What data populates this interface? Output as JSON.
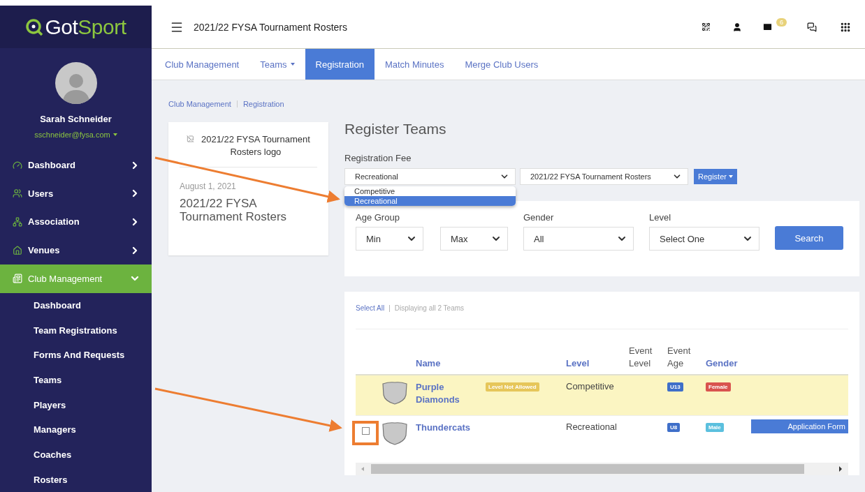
{
  "brand": {
    "first": "Got",
    "second": "Sport"
  },
  "topbar": {
    "title": "2021/22 FYSA Tournament Rosters",
    "mail_badge": "6"
  },
  "user": {
    "name": "Sarah Schneider",
    "email": "sschneider@fysa.com"
  },
  "sidebar": {
    "items": [
      {
        "label": "Dashboard",
        "kind": "gauge",
        "selected": false,
        "expanded": false
      },
      {
        "label": "Users",
        "kind": "users",
        "selected": false,
        "expanded": false
      },
      {
        "label": "Association",
        "kind": "network",
        "selected": false,
        "expanded": false
      },
      {
        "label": "Venues",
        "kind": "home",
        "selected": false,
        "expanded": false
      },
      {
        "label": "Club Management",
        "kind": "list",
        "selected": true,
        "expanded": true,
        "children": [
          {
            "label": "Dashboard",
            "selected": false
          },
          {
            "label": "Team Registrations",
            "selected": false
          },
          {
            "label": "Forms And Requests",
            "selected": false
          },
          {
            "label": "Teams",
            "selected": false
          },
          {
            "label": "Players",
            "selected": false
          },
          {
            "label": "Managers",
            "selected": false
          },
          {
            "label": "Coaches",
            "selected": false
          },
          {
            "label": "Rosters",
            "selected": false
          }
        ]
      }
    ]
  },
  "tabs": [
    {
      "label": "Club Management",
      "selected": false,
      "dropdown": false
    },
    {
      "label": "Teams",
      "selected": false,
      "dropdown": true
    },
    {
      "label": "Registration",
      "selected": true,
      "dropdown": false
    },
    {
      "label": "Match Minutes",
      "selected": false,
      "dropdown": false
    },
    {
      "label": "Merge Club Users",
      "selected": false,
      "dropdown": false
    }
  ],
  "breadcrumb": [
    "Club Management",
    "Registration"
  ],
  "event_card": {
    "image_alt": "2021/22 FYSA Tournament Rosters logo",
    "date": "August 1, 2021",
    "name": "2021/22 FYSA Tournament Rosters"
  },
  "register": {
    "heading": "Register Teams",
    "fee_label": "Registration Fee",
    "fee_value": "Recreational",
    "fee_options": [
      {
        "label": "Competitive",
        "selected": false
      },
      {
        "label": "Recreational",
        "selected": true
      }
    ],
    "event_value": "2021/22 FYSA Tournament Rosters",
    "register_button": "Register"
  },
  "filters": {
    "age_label": "Age Group",
    "age_min": "Min",
    "age_max": "Max",
    "gender_label": "Gender",
    "gender_value": "All",
    "level_label": "Level",
    "level_value": "Select One",
    "search_button": "Search"
  },
  "teams": {
    "select_all": "Select All",
    "separator": "|",
    "summary": "Displaying all 2 Teams",
    "columns": [
      {
        "label": "Name",
        "sortable": true
      },
      {
        "label": "Level",
        "sortable": true
      },
      {
        "label": "Event Level",
        "sortable": false
      },
      {
        "label": "Event Age",
        "sortable": false
      },
      {
        "label": "Gender",
        "sortable": true
      }
    ],
    "rows": [
      {
        "name": "Purple Diamonds",
        "warning": "Level Not Allowed",
        "level": "Competitive",
        "age": "U13",
        "gender": "Female",
        "color": "#d9534f",
        "highlighted": true,
        "selectable": false
      },
      {
        "name": "Thundercats",
        "level": "Recreational",
        "age": "U8",
        "gender": "Male",
        "color": "#5bc0de",
        "highlighted": false,
        "selectable": true,
        "checked": false,
        "action": "Application Form"
      }
    ]
  }
}
